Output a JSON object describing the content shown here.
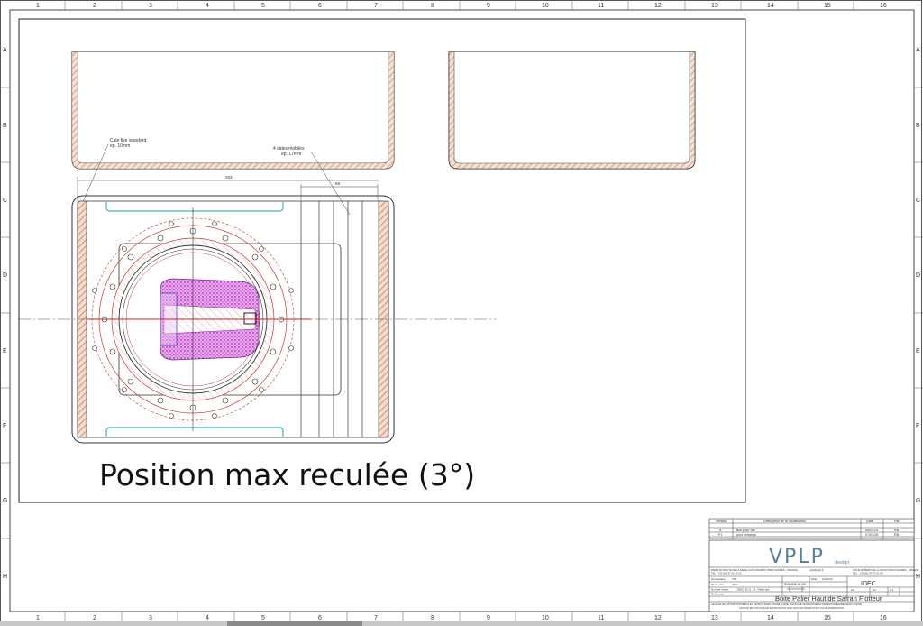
{
  "frame": {
    "col_numbers": [
      "1",
      "2",
      "3",
      "4",
      "5",
      "6",
      "7",
      "8",
      "9",
      "10",
      "11",
      "12",
      "13",
      "14",
      "15",
      "16"
    ],
    "row_letters": [
      "A",
      "B",
      "C",
      "D",
      "E",
      "F",
      "G",
      "H"
    ]
  },
  "drawing": {
    "caption": "Position max reculée (3°)",
    "annotations": {
      "fixed_wedge_1": "Cale fixe standard",
      "fixed_wedge_2": "ep. 10mm",
      "mobile_wedges_1": "4 cales mobiles",
      "mobile_wedges_2": "ep. 17mm",
      "dim_main": "283",
      "dim_wedges": "68"
    }
  },
  "revisions": {
    "headers": {
      "version": "Version",
      "description": "Description de la modification",
      "date": "Date",
      "by": "Par"
    },
    "rows": [
      {
        "version": "A",
        "description": "Bon pour fab",
        "date": "06/03/19",
        "by": "RB"
      },
      {
        "version": "P1",
        "description": "pour échange",
        "date": "07/01/18",
        "by": "RB"
      }
    ]
  },
  "title_block": {
    "logo_main": "VPLP",
    "logo_sub": "design",
    "address_left": "PARIS 50 ROUTE DE LA MERE AUX CANARDS 78080 VANNES - FRANCE",
    "phone_left": "TEL : +33 (0)2 97 00 14 20",
    "email": "vplp@vplp.fr",
    "address_right": "3 RUE ROBERT DE LA CROIX 56100 VANNES - FRANCE",
    "phone_right": "TEL : +33 (0)2 97 67 01 08",
    "labels": {
      "designer": "Dessinateur",
      "drawing_no": "N° de plan",
      "file_name": "Nom de fichier",
      "reference": "Référence",
      "tolerance": "Dimension en mm",
      "date": "Date",
      "format": "Format",
      "scale": "Échelle",
      "page": "Page"
    },
    "values": {
      "designer": "TM",
      "drawing_no": "4011",
      "file_name": "IDEC 40 11 - B - Palier.pdf",
      "date": "11/02/19",
      "format": "A3",
      "sheet": "1/1",
      "page": "A3"
    },
    "client": "IDEC",
    "drawing_title": "Boite Palier Haut de Safran Flotteur",
    "disclaimer_1": "CE PLAN EST NOTRE PROPRIÉTÉ ET NE PEUT ÊTRE UTILISÉ, COPIÉ, DIVULGUÉ SANS NOTRE AUTORISATION EXPRESSE ET ÉCRITE.",
    "disclaimer_2": "CE PLAN EST UN PLAN DE DÉFINITION ET NON UN PLAN D'EXÉCUTION OU DE FABRICATION."
  },
  "colors": {
    "section_fill": "#c97d5a",
    "tube": "#cc3333",
    "hatch_purple": "#b03ab8",
    "wedge_cyan": "#3fb5bd",
    "logo": "#5a7f98"
  }
}
